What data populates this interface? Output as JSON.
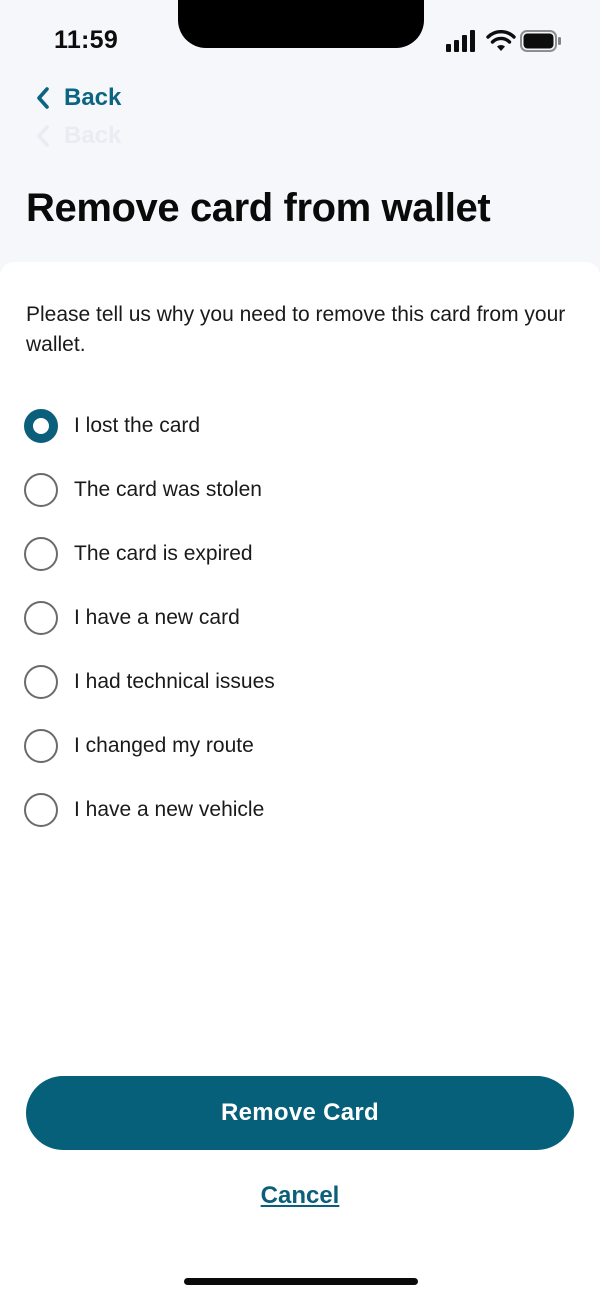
{
  "status_bar": {
    "time": "11:59",
    "icons": [
      "cellular-signal-icon",
      "wifi-icon",
      "battery-icon"
    ]
  },
  "header": {
    "back_label": "Back",
    "back_ghost_label": "Back",
    "title": "Remove card from wallet"
  },
  "form": {
    "prompt": "Please tell us why you need to remove this card from your wallet.",
    "selected_index": 0,
    "options": [
      "I lost the card",
      "The card was stolen",
      "The card is expired",
      "I have a new card",
      "I had technical issues",
      "I changed my route",
      "I have a new vehicle"
    ]
  },
  "actions": {
    "primary_label": "Remove Card",
    "cancel_label": "Cancel"
  },
  "colors": {
    "accent": "#06607a",
    "link": "#0b6480",
    "header_background": "#f6f7fb",
    "content_background": "#ffffff"
  }
}
